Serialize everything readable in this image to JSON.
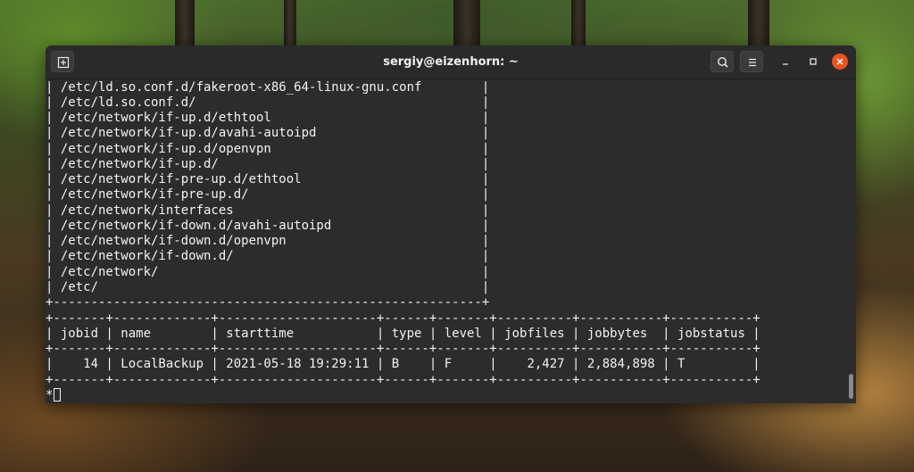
{
  "window": {
    "title": "sergiy@eizenhorn: ~"
  },
  "titlebar_icons": {
    "new_tab": "new-tab-icon",
    "search": "search-icon",
    "menu": "hamburger-menu-icon",
    "minimize": "minimize-icon",
    "maximize": "maximize-icon",
    "close": "close-icon"
  },
  "colors": {
    "terminal_bg": "#2c2c2c",
    "terminal_fg": "#f2f2f2",
    "close_button": "#e95420"
  },
  "terminal": {
    "file_list": [
      "| /etc/ld.so.conf.d/fakeroot-x86_64-linux-gnu.conf        |",
      "| /etc/ld.so.conf.d/                                      |",
      "| /etc/network/if-up.d/ethtool                            |",
      "| /etc/network/if-up.d/avahi-autoipd                      |",
      "| /etc/network/if-up.d/openvpn                            |",
      "| /etc/network/if-up.d/                                   |",
      "| /etc/network/if-pre-up.d/ethtool                        |",
      "| /etc/network/if-pre-up.d/                               |",
      "| /etc/network/interfaces                                 |",
      "| /etc/network/if-down.d/avahi-autoipd                    |",
      "| /etc/network/if-down.d/openvpn                          |",
      "| /etc/network/if-down.d/                                 |",
      "| /etc/network/                                           |",
      "| /etc/                                                   |",
      "+---------------------------------------------------------+"
    ],
    "jobs_table": {
      "border": "+-------+-------------+---------------------+------+-------+----------+-----------+-----------+",
      "header": "| jobid | name        | starttime           | type | level | jobfiles | jobbytes  | jobstatus |",
      "rows": [
        "|    14 | LocalBackup | 2021-05-18 19:29:11 | B    | F     |    2,427 | 2,884,898 | T         |"
      ]
    },
    "prompt": "*"
  }
}
